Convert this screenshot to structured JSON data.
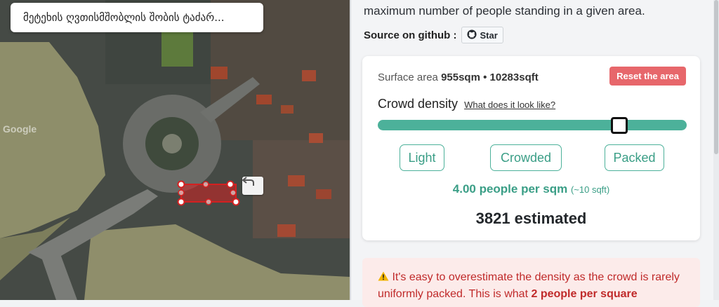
{
  "map": {
    "place_name": "მეტეხის ღვთისმშობლის შობის ტაძარ...",
    "google_label": "Google",
    "undo_icon": "undo-icon"
  },
  "panel": {
    "intro_text": "maximum number of people standing in a given area.",
    "source_label": "Source on github :",
    "star_label": "Star",
    "star_icon": "github-icon"
  },
  "card": {
    "surface_label": "Surface area",
    "surface_value": "955sqm • 10283sqft",
    "reset_label": "Reset the area",
    "density_title": "Crowd density",
    "density_link": "What does it look like?",
    "slider_value_fraction": 0.78,
    "presets": [
      "Light",
      "Crowded",
      "Packed"
    ],
    "people_per_sqm": "4.00 people per sqm",
    "people_hint": "(~10 sqft)",
    "estimate": "3821 estimated"
  },
  "warning": {
    "icon": "warning-icon",
    "text_start": "It's easy to overestimate the density as the crowd is rarely uniformly packed. This is what ",
    "text_bold": "2 people per square"
  },
  "colors": {
    "accent": "#4cb19a",
    "reset": "#e7676b",
    "warning_text": "#c02a2a",
    "warning_bg": "#fcebea",
    "selection": "#d42020"
  }
}
